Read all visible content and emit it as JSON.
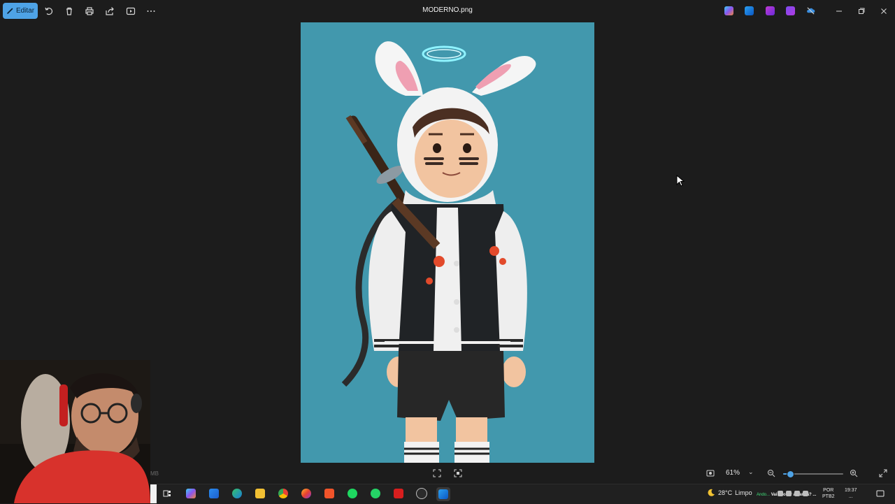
{
  "window": {
    "title": "MODERNO.png",
    "edit_label": "Editar"
  },
  "toolbar": {
    "icons": [
      "rotate-icon",
      "delete-icon",
      "print-icon",
      "share-icon",
      "slideshow-icon",
      "more-icon"
    ]
  },
  "header_apps": [
    "copilot-icon",
    "photos-icon",
    "clipchamp-icon",
    "designer-icon",
    "onedrive-offline-icon"
  ],
  "status": {
    "file_size_suffix": "MB",
    "zoom_label": "61%",
    "zoom_fraction": 0.12
  },
  "taskbar": {
    "apps": [
      "task-view",
      "copilot",
      "microsoft-store",
      "edge",
      "file-explorer",
      "chrome",
      "firefox",
      "brave",
      "spotify",
      "whatsapp",
      "red-app",
      "clock-app",
      "photos"
    ],
    "weather_temp": "28°C",
    "weather_desc": "Limpo",
    "ticker_green": "Ando...",
    "ticker_white": "Vai chover amanhã? ...",
    "language": "POR",
    "language_sub": "PTB2",
    "time": "19:37",
    "date": "..."
  },
  "colors": {
    "accent": "#4ea3e6",
    "image_bg": "#4298ad",
    "app_bg": "#1c1c1c"
  }
}
